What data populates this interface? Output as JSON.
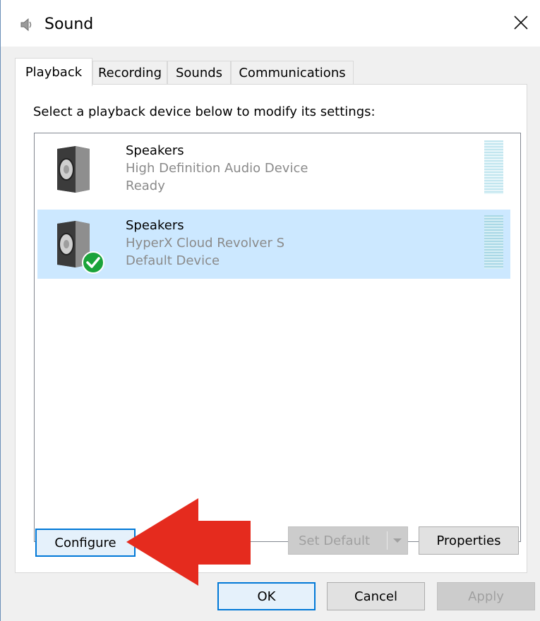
{
  "window": {
    "title": "Sound",
    "close_symbol": "✕"
  },
  "tabs": [
    {
      "label": "Playback",
      "active": true
    },
    {
      "label": "Recording",
      "active": false
    },
    {
      "label": "Sounds",
      "active": false
    },
    {
      "label": "Communications",
      "active": false
    }
  ],
  "playback": {
    "instruction": "Select a playback device below to modify its settings:",
    "devices": [
      {
        "name": "Speakers",
        "description": "High Definition Audio Device",
        "status": "Ready",
        "selected": false,
        "default": false
      },
      {
        "name": "Speakers",
        "description": "HyperX Cloud Revolver S",
        "status": "Default Device",
        "selected": true,
        "default": true
      }
    ]
  },
  "buttons": {
    "configure": "Configure",
    "set_default": "Set Default",
    "properties": "Properties",
    "ok": "OK",
    "cancel": "Cancel",
    "apply": "Apply"
  },
  "icons": {
    "window_icon": "speaker-icon",
    "device_icon": "speaker-icon",
    "default_badge": "green-check-icon",
    "annotation": "red-arrow-icon"
  },
  "colors": {
    "selection": "#cce8ff",
    "focus_border": "#0078d7",
    "default_check": "#1aa33a",
    "annotation_arrow": "#e52b1e"
  }
}
